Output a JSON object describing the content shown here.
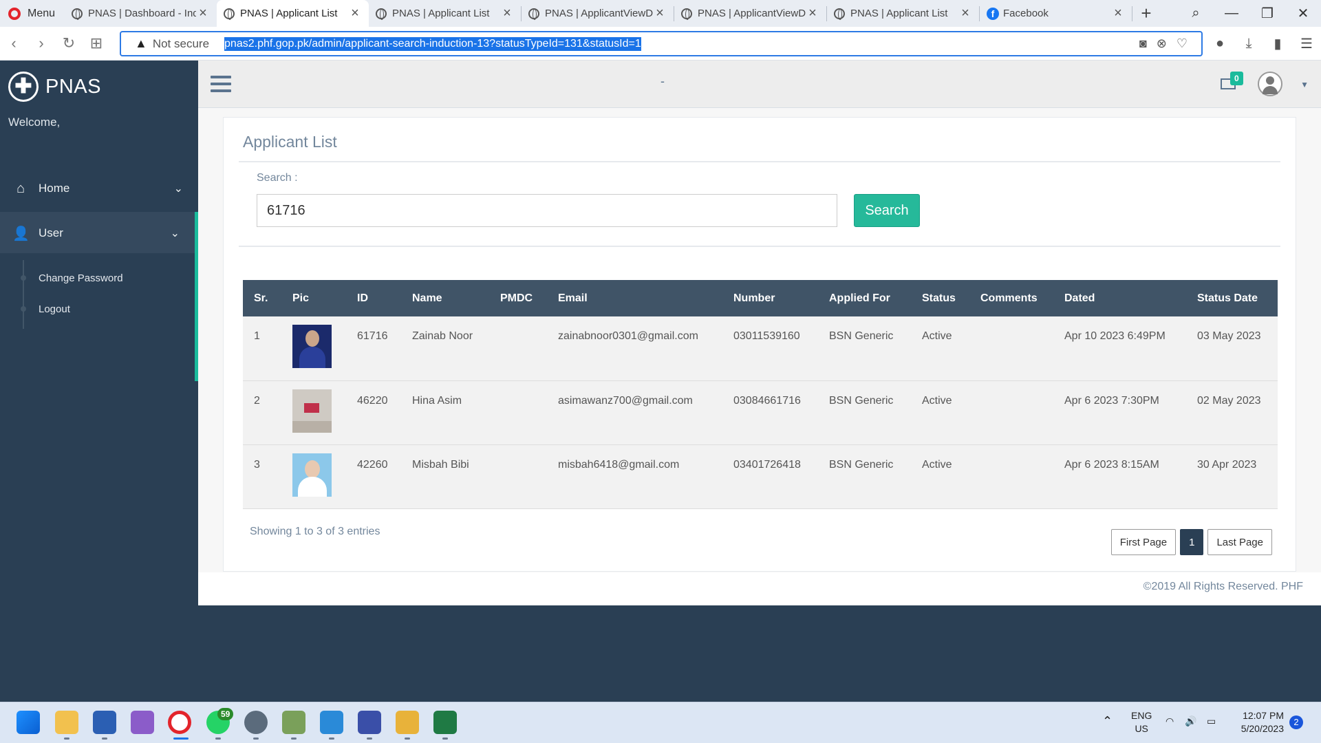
{
  "browser": {
    "menu_label": "Menu",
    "tabs": [
      {
        "title": "PNAS | Dashboard - Ind"
      },
      {
        "title": "PNAS | Applicant List"
      },
      {
        "title": "PNAS | Applicant List"
      },
      {
        "title": "PNAS | ApplicantViewD"
      },
      {
        "title": "PNAS | ApplicantViewD"
      },
      {
        "title": "PNAS | Applicant List"
      },
      {
        "title": "Facebook"
      }
    ],
    "security_label": "Not secure",
    "url": "pnas2.phf.gop.pk/admin/applicant-search-induction-13?statusTypeId=131&statusId=1"
  },
  "sidebar": {
    "brand": "PNAS",
    "welcome": "Welcome,",
    "items": [
      {
        "label": "Home"
      },
      {
        "label": "User"
      }
    ],
    "subitems": [
      {
        "label": "Change Password"
      },
      {
        "label": "Logout"
      }
    ]
  },
  "topnav": {
    "center_text": "-",
    "mail_count": "0"
  },
  "panel": {
    "title": "Applicant List",
    "search_label": "Search :",
    "search_value": "61716",
    "search_button": "Search"
  },
  "table": {
    "headers": [
      "Sr.",
      "Pic",
      "ID",
      "Name",
      "PMDC",
      "Email",
      "Number",
      "Applied For",
      "Status",
      "Comments",
      "Dated",
      "Status Date"
    ],
    "rows": [
      {
        "sr": "1",
        "id": "61716",
        "name": "Zainab Noor",
        "pmdc": "",
        "email": "zainabnoor0301@gmail.com",
        "number": "03011539160",
        "applied_for": "BSN Generic",
        "status": "Active",
        "comments": "",
        "dated": "Apr 10 2023 6:49PM",
        "status_date": "03 May 2023"
      },
      {
        "sr": "2",
        "id": "46220",
        "name": "Hina Asim",
        "pmdc": "",
        "email": "asimawanz700@gmail.com",
        "number": "03084661716",
        "applied_for": "BSN Generic",
        "status": "Active",
        "comments": "",
        "dated": "Apr 6 2023 7:30PM",
        "status_date": "02 May 2023"
      },
      {
        "sr": "3",
        "id": "42260",
        "name": "Misbah Bibi",
        "pmdc": "",
        "email": "misbah6418@gmail.com",
        "number": "03401726418",
        "applied_for": "BSN Generic",
        "status": "Active",
        "comments": "",
        "dated": "Apr 6 2023 8:15AM",
        "status_date": "30 Apr 2023"
      }
    ]
  },
  "pagination": {
    "showing": "Showing 1 to 3 of 3 entries",
    "first": "First Page",
    "current": "1",
    "last": "Last Page"
  },
  "footer": {
    "text": "©2019 All Rights Reserved. PHF"
  },
  "taskbar": {
    "whatsapp_badge": "59",
    "lang_top": "ENG",
    "lang_bottom": "US",
    "time": "12:07 PM",
    "date": "5/20/2023",
    "notif_count": "2"
  },
  "colors": {
    "sidebar": "#2a3f54",
    "accent": "#1abb9c",
    "search_button": "#26b99a",
    "table_header": "#405467"
  }
}
